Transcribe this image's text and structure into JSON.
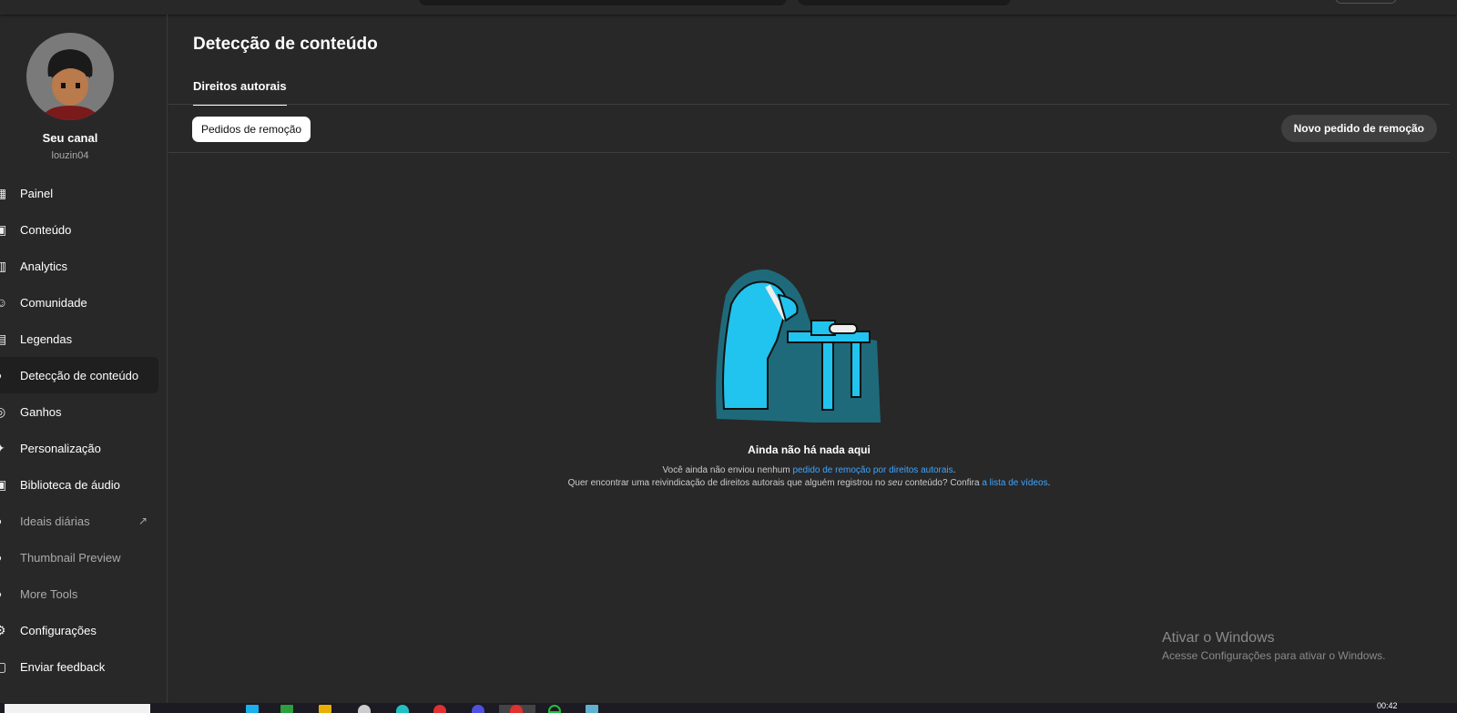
{
  "sidebar": {
    "channel_title": "Seu canal",
    "channel_handle": "louzin04",
    "items": [
      {
        "label": "Painel",
        "icon": "dashboard-icon"
      },
      {
        "label": "Conteúdo",
        "icon": "content-icon"
      },
      {
        "label": "Analytics",
        "icon": "analytics-icon"
      },
      {
        "label": "Comunidade",
        "icon": "community-icon"
      },
      {
        "label": "Legendas",
        "icon": "subtitles-icon"
      },
      {
        "label": "Detecção de conteúdo",
        "icon": "copyright-icon",
        "active": true
      },
      {
        "label": "Ganhos",
        "icon": "earn-icon"
      },
      {
        "label": "Personalização",
        "icon": "customization-icon"
      },
      {
        "label": "Biblioteca de áudio",
        "icon": "audio-library-icon"
      },
      {
        "label": "Ideais diárias",
        "icon": "extension-icon"
      },
      {
        "label": "Thumbnail Preview",
        "icon": "extension-icon"
      },
      {
        "label": "More Tools",
        "icon": "extension-icon"
      },
      {
        "label": "Configurações",
        "icon": "settings-icon"
      },
      {
        "label": "Enviar feedback",
        "icon": "feedback-icon"
      }
    ]
  },
  "main": {
    "title": "Detecção de conteúdo",
    "tab": "Direitos autorais",
    "chip": "Pedidos de remoção",
    "new_button": "Novo pedido de remoção",
    "empty_title": "Ainda não há nada aqui",
    "line1_pre": "Você ainda não enviou nenhum ",
    "line1_link": "pedido de remoção por direitos autorais",
    "line1_post": ".",
    "line2_pre": "Quer encontrar uma reivindicação de direitos autorais que alguém registrou no ",
    "line2_em": "seu",
    "line2_mid": " conteúdo? Confira ",
    "line2_link": "a lista de vídeos",
    "line2_post": "."
  },
  "watermark": {
    "title": "Ativar o Windows",
    "subtitle": "Acesse Configurações para ativar o Windows."
  },
  "taskbar": {
    "clock": "00:42"
  }
}
